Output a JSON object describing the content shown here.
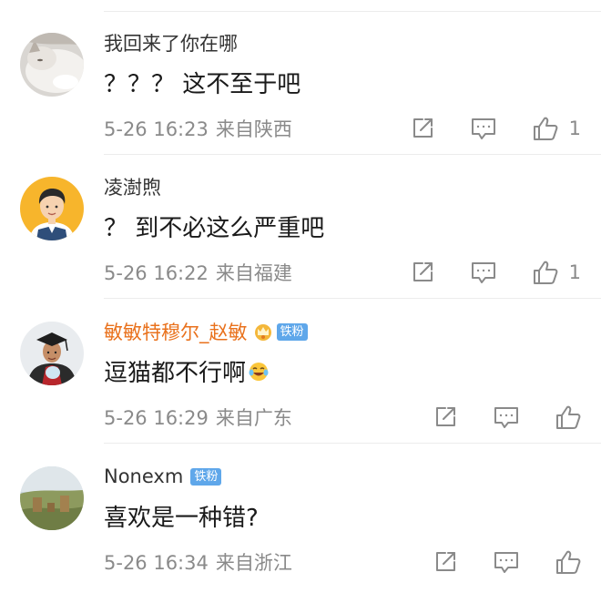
{
  "comments": [
    {
      "username": "我回来了你在哪",
      "text": "？？？ 这不至于吧",
      "date": "5-26 16:23",
      "location": "来自陕西",
      "likes": "1",
      "avatar_icon": "cat-avatar",
      "vip": false
    },
    {
      "username": "凌澍煦",
      "text": "？ 到不必这么严重吧",
      "date": "5-26 16:22",
      "location": "来自福建",
      "likes": "1",
      "avatar_icon": "cartoon-man-avatar",
      "vip": false
    },
    {
      "username": "敏敏特穆尔_赵敏",
      "badge": "铁粉",
      "text": "逗猫都不行啊",
      "emoji": "laughing-tears-emoji",
      "date": "5-26 16:29",
      "location": "来自广东",
      "likes": "",
      "avatar_icon": "graduate-photo-avatar",
      "vip": true,
      "vip_color": "#e9711c"
    },
    {
      "username": "Nonexm",
      "badge": "铁粉",
      "text": "喜欢是一种错?",
      "date": "5-26 16:34",
      "location": "来自浙江",
      "likes": "",
      "avatar_icon": "landscape-avatar",
      "vip": false
    }
  ],
  "colors": {
    "badge": "#5fa7ea",
    "meta": "#8a8a8a",
    "divider": "#ececec"
  },
  "icons": {
    "share": "share-icon",
    "reply": "comment-icon",
    "like": "thumbs-up-icon"
  }
}
